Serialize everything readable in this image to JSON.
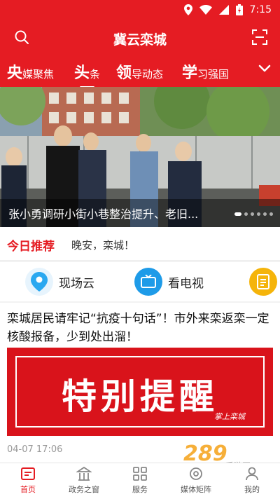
{
  "status_bar": {
    "time": "7:15"
  },
  "header": {
    "title": "冀云栾城"
  },
  "tabs": [
    {
      "big": "央",
      "small": "媒聚焦"
    },
    {
      "big": "头",
      "small": "条"
    },
    {
      "big": "领",
      "small": "导动态"
    },
    {
      "big": "学",
      "small": "习强国"
    }
  ],
  "banner": {
    "caption": "张小勇调研小街小巷整治提升、老旧..."
  },
  "recommend": {
    "label": "今日推荐",
    "text": "晚安，栾城！"
  },
  "services": [
    {
      "name": "现场云",
      "icon": "location-pin-icon",
      "color": "#2aa8f0"
    },
    {
      "name": "看电视",
      "icon": "tv-icon",
      "color": "#1e9be8"
    },
    {
      "name": "",
      "icon": "document-icon",
      "color": "#f5b40a"
    }
  ],
  "news": {
    "headline": "栾城居民请牢记“抗疫十句话”！市外来栾返栾一定核酸报备，少到处出溜！",
    "poster_text": "特别提醒",
    "poster_signature": "掌上栾城",
    "time": "04-07 17:06"
  },
  "bottom_nav": [
    {
      "label": "首页",
      "icon": "home-icon"
    },
    {
      "label": "政务之窗",
      "icon": "government-icon"
    },
    {
      "label": "服务",
      "icon": "grid-icon"
    },
    {
      "label": "媒体矩阵",
      "icon": "media-icon"
    },
    {
      "label": "我的",
      "icon": "user-icon"
    }
  ],
  "watermark": {
    "logo": "289",
    "sub": "手游网"
  },
  "colors": {
    "brand_red": "#e51c23"
  }
}
